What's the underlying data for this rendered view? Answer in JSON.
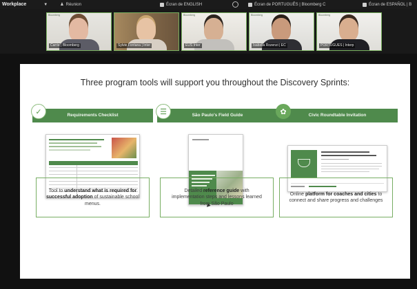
{
  "topbar": {
    "app": "Workplace",
    "meeting": "Réunion",
    "channels": [
      "Écran de ENGLISH",
      "Écran de PORTUGUÊS | Bloomberg C",
      "Écran de ESPAÑOL | B"
    ]
  },
  "participants": [
    {
      "name": "Carrie | Bloomberg",
      "tile_label": "Bloomberg"
    },
    {
      "name": "Sylvie Fontana | Inter",
      "tile_label": ""
    },
    {
      "name": "EUS Inter",
      "tile_label": "Bloomberg"
    },
    {
      "name": "Isabella Rozenzi | EC",
      "tile_label": "Bloomberg"
    },
    {
      "name": "PORTUGUES | Interp",
      "tile_label": "Bloomberg"
    }
  ],
  "slide": {
    "title": "Three program tools will support you throughout the Discovery Sprints:",
    "columns": [
      {
        "banner": "Requirements Checklist",
        "badge_icon": "checkmark-icon",
        "desc": {
          "a": "Tool to ",
          "b": "understand what is required for successful adoption",
          "c": " of sustainable school menus."
        }
      },
      {
        "banner": "São Paulo's Field Guide",
        "badge_icon": "list-icon",
        "desc": {
          "a": "Detailed ",
          "b": "reference guide",
          "c": " with implementation steps and lessons learned from São Paulo"
        }
      },
      {
        "banner": "Civic Roundtable Invitation",
        "badge_icon": "leaf-icon",
        "desc": {
          "a": "Online ",
          "b": "platform for coaches and cities",
          "c": " to connect and share progress and challenges"
        }
      }
    ]
  },
  "colors": {
    "accent": "#4f8a4c",
    "tile_border": "#79b25f"
  }
}
